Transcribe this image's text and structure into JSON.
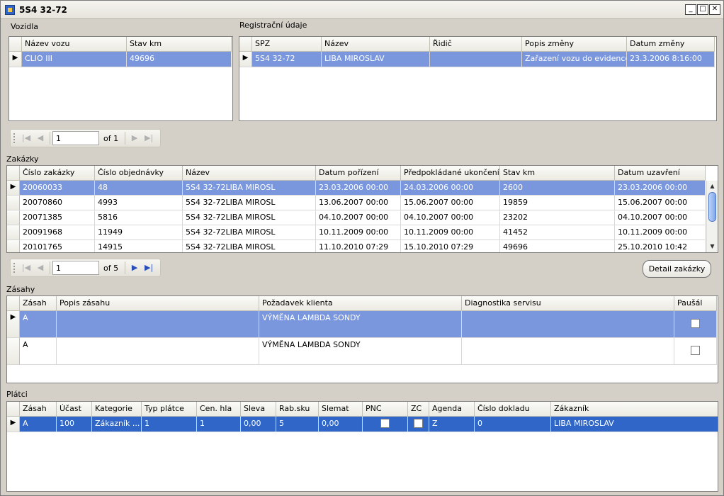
{
  "window": {
    "title": "5S4 32-72"
  },
  "vozidla": {
    "label": "Vozidla",
    "columns": [
      "Název vozu",
      "Stav km"
    ],
    "rows": [
      {
        "cells": [
          "CLIO III",
          "49696"
        ],
        "selected": true
      }
    ]
  },
  "registracni": {
    "label": "Registrační údaje",
    "columns": [
      "SPZ",
      "Název",
      "Řidič",
      "Popis změny",
      "Datum změny"
    ],
    "rows": [
      {
        "cells": [
          "5S4 32-72",
          "LIBA MIROSLAV",
          "",
          "Zařazení vozu do evidence...",
          "23.3.2006 8:16:00"
        ],
        "selected": true
      }
    ]
  },
  "navigator1": {
    "page": "1",
    "of_label": "of 1"
  },
  "zakazky": {
    "label": "Zakázky",
    "columns": [
      "Číslo zakázky",
      "Číslo objednávky",
      "Název",
      "Datum pořízení",
      "Předpokládané ukončení",
      "Stav km",
      "Datum uzavření"
    ],
    "rows": [
      {
        "cells": [
          "20060033",
          "48",
          "5S4 32-72LIBA MIROSL",
          "23.03.2006 00:00",
          "24.03.2006 00:00",
          "2600",
          "23.03.2006 00:00"
        ],
        "selected": true
      },
      {
        "cells": [
          "20070860",
          "4993",
          "5S4 32-72LIBA MIROSL",
          "13.06.2007 00:00",
          "15.06.2007 00:00",
          "19859",
          "15.06.2007 00:00"
        ]
      },
      {
        "cells": [
          "20071385",
          "5816",
          "5S4 32-72LIBA MIROSL",
          "04.10.2007 00:00",
          "04.10.2007 00:00",
          "23202",
          "04.10.2007 00:00"
        ]
      },
      {
        "cells": [
          "20091968",
          "11949",
          "5S4 32-72LIBA MIROSL",
          "10.11.2009 00:00",
          "10.11.2009 00:00",
          "41452",
          "10.11.2009 00:00"
        ]
      },
      {
        "cells": [
          "20101765",
          "14915",
          "5S4 32-72LIBA MIROSL",
          "11.10.2010 07:29",
          "15.10.2010 07:29",
          "49696",
          "25.10.2010 10:42"
        ]
      }
    ]
  },
  "navigator2": {
    "page": "1",
    "of_label": "of 5"
  },
  "detail_button": "Detail zakázky",
  "zasahy": {
    "label": "Zásahy",
    "columns": [
      "Zásah",
      "Popis zásahu",
      "Požadavek klienta",
      "Diagnostika servisu",
      "Paušál"
    ],
    "rows": [
      {
        "cells": [
          "A",
          "",
          "VÝMĚNA LAMBDA SONDY",
          ""
        ],
        "pausal": false,
        "selected": true
      },
      {
        "cells": [
          "A",
          "",
          "VÝMĚNA LAMBDA SONDY",
          ""
        ],
        "pausal": false
      }
    ]
  },
  "platci": {
    "label": "Plátci",
    "columns": [
      "Zásah",
      "Účast",
      "Kategorie",
      "Typ plátce",
      "Cen. hla",
      "Sleva",
      "Rab.sku",
      "Slemat",
      "PNC",
      "ZC",
      "Agenda",
      "Číslo dokladu",
      "Zákazník"
    ],
    "rows": [
      {
        "cells": [
          "A",
          "100",
          "Zákazník ...",
          "1",
          "1",
          "0,00",
          "5",
          "0,00",
          "",
          "",
          "Z",
          "0",
          "LIBA MIROSLAV"
        ],
        "selected": true
      }
    ]
  },
  "icons": {
    "first": "first-page-icon",
    "prev": "prev-page-icon",
    "next": "next-page-icon",
    "last": "last-page-icon",
    "row_pointer": "row-pointer-icon"
  }
}
